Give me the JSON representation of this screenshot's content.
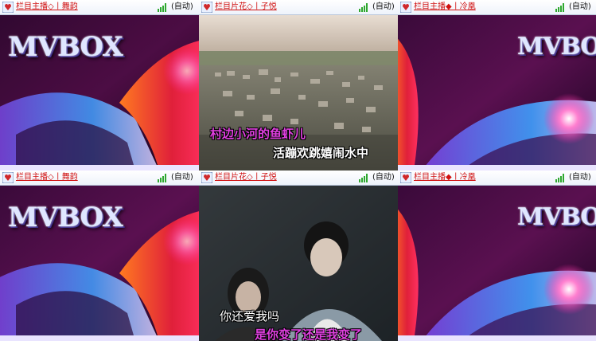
{
  "rows": [
    {
      "cells": [
        {
          "title": "栏目主播◇丨舞韵",
          "status": "(自动)"
        },
        {
          "title": "栏目片花◇丨子悦",
          "status": "(自动)"
        },
        {
          "title": "栏目主播◆丨冷凰",
          "status": "(自动)"
        }
      ],
      "left_logo": "MVBOX",
      "right_logo": "MVBOX",
      "lyrics": [
        "村边小河的鱼虾儿",
        "活蹦欢跳嬉闹水中"
      ]
    },
    {
      "cells": [
        {
          "title": "栏目主播◇丨舞韵",
          "status": "(自动)"
        },
        {
          "title": "栏目片花◇丨子悦",
          "status": "(自动)"
        },
        {
          "title": "栏目主播◆丨冷凰",
          "status": "(自动)"
        }
      ],
      "left_logo": "MVBOX",
      "right_logo": "MVBOX",
      "lyrics": [
        "你还爱我吗",
        "是你变了还是我变了"
      ]
    }
  ],
  "colors": {
    "title_text": "#d01010",
    "lyric_highlight": "#e040e0",
    "lyric_plain": "#ffffff"
  },
  "icons": {
    "channel": "heart-shield-icon",
    "signal": "signal-bars-icon"
  }
}
